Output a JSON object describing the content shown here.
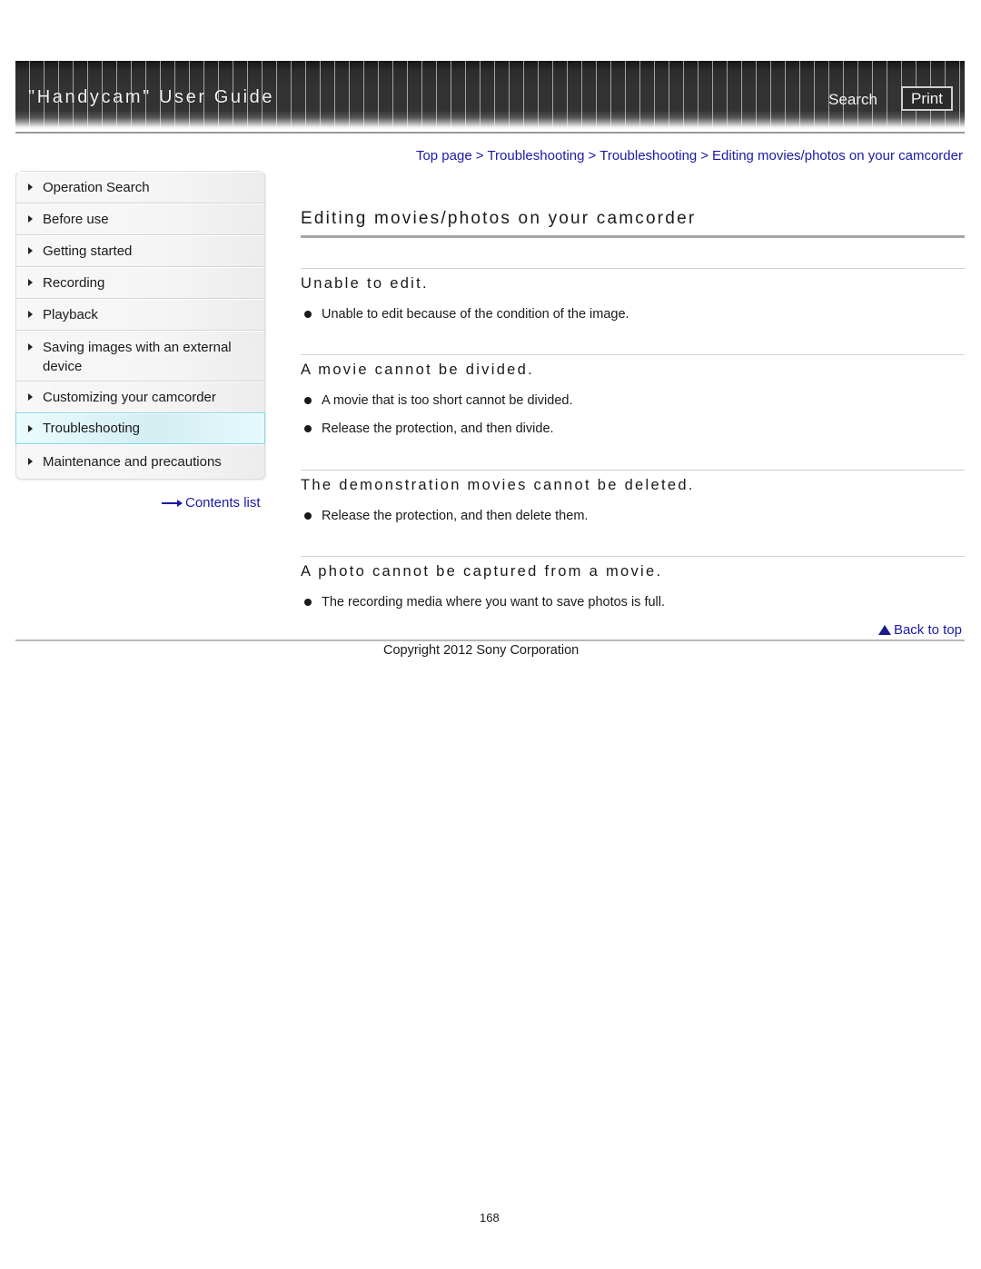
{
  "header": {
    "title": "\"Handycam\" User Guide",
    "search_label": "Search",
    "print_label": "Print"
  },
  "breadcrumb": {
    "items": [
      "Top page",
      "Troubleshooting",
      "Troubleshooting",
      "Editing movies/photos on your camcorder"
    ],
    "separator": ">"
  },
  "sidebar": {
    "items": [
      {
        "label": "Operation Search",
        "active": false
      },
      {
        "label": "Before use",
        "active": false
      },
      {
        "label": "Getting started",
        "active": false
      },
      {
        "label": "Recording",
        "active": false
      },
      {
        "label": "Playback",
        "active": false
      },
      {
        "label": "Saving images with an external device",
        "active": false
      },
      {
        "label": "Customizing your camcorder",
        "active": false
      },
      {
        "label": "Troubleshooting",
        "active": true
      },
      {
        "label": "Maintenance and precautions",
        "active": false
      }
    ],
    "contents_link": "Contents list"
  },
  "main": {
    "title": "Editing movies/photos on your camcorder",
    "sections": [
      {
        "heading": "Unable to edit.",
        "bullets": [
          "Unable to edit because of the condition of the image."
        ]
      },
      {
        "heading": "A movie cannot be divided.",
        "bullets": [
          "A movie that is too short cannot be divided.",
          "Release the protection, and then divide."
        ]
      },
      {
        "heading": "The demonstration movies cannot be deleted.",
        "bullets": [
          "Release the protection, and then delete them."
        ]
      },
      {
        "heading": "A photo cannot be captured from a movie.",
        "bullets": [
          "The recording media where you want to save photos is full."
        ]
      }
    ],
    "back_to_top": "Back to top"
  },
  "footer": {
    "copyright": "Copyright 2012 Sony Corporation",
    "page_number": "168"
  },
  "colors": {
    "link": "#1a1aa6",
    "header_bg": "#333333",
    "active_nav_border": "#7fd6ea"
  }
}
